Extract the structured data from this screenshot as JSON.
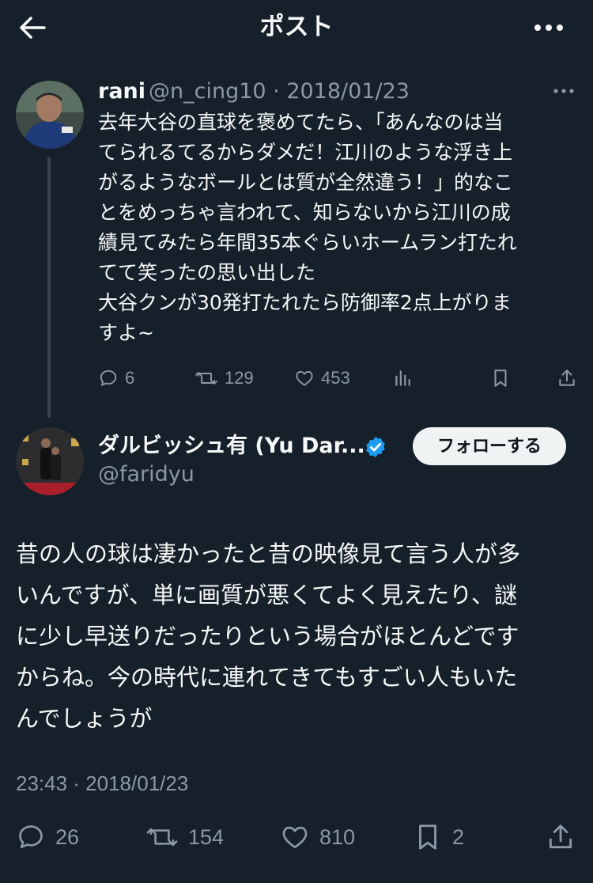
{
  "header": {
    "title": "ポスト",
    "back_icon": "arrow-left-icon",
    "more_icon": "ellipsis-icon"
  },
  "parent_post": {
    "display_name": "rani",
    "meta": "@n_cing10 · 2018/01/23",
    "text": "去年大谷の直球を褒めてたら、「あんなのは当\nてられるてるからダメだ！江川のような浮き上\nがるようなボールとは質が全然違う！」的なこ\nとをめっちゃ言われて、知らないから江川の成\n績見てみたら年間35本ぐらいホームラン打たれ\nてて笑ったの思い出した\n大谷クンが30発打たれたら防御率2点上がりま\nすよ~",
    "replies": "6",
    "reposts": "129",
    "likes": "453"
  },
  "main_post": {
    "display_name": "ダルビッシュ有 (Yu Dar...",
    "handle": "@faridyu",
    "follow_label": "フォローする",
    "text": "昔の人の球は凄かったと昔の映像見て言う人が多\nいんですが、単に画質が悪くてよく見えたり、謎\nに少し早送りだったりという場合がほとんどです\nからね。今の時代に連れてきてもすごい人もいた\nんでしょうが",
    "timestamp": "23:43 · 2018/01/23",
    "replies": "26",
    "reposts": "154",
    "likes": "810",
    "bookmarks": "2"
  },
  "colors": {
    "background": "#15202b",
    "text": "#f7f9f9",
    "secondary": "#8b98a5",
    "verified": "#1d9bf0"
  }
}
